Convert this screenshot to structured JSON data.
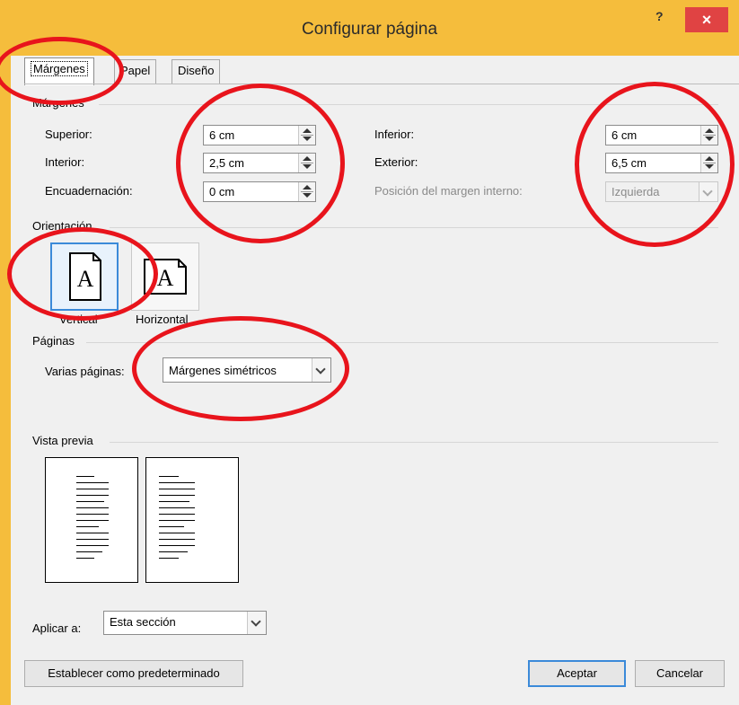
{
  "window": {
    "title": "Configurar página",
    "help": "?",
    "close": "×"
  },
  "tabs": [
    {
      "label": "Márgenes",
      "active": true
    },
    {
      "label": "Papel",
      "active": false
    },
    {
      "label": "Diseño",
      "active": false
    }
  ],
  "margins": {
    "section_label": "Márgenes",
    "superior": {
      "label": "Superior:",
      "value": "6 cm"
    },
    "interior": {
      "label": "Interior:",
      "value": "2,5 cm"
    },
    "encuadernacion": {
      "label": "Encuadernación:",
      "value": "0 cm"
    },
    "inferior": {
      "label": "Inferior:",
      "value": "6 cm"
    },
    "exterior": {
      "label": "Exterior:",
      "value": "6,5 cm"
    },
    "gutter_position": {
      "label": "Posición del margen interno:",
      "value": "Izquierda",
      "enabled": false
    }
  },
  "orientation": {
    "section_label": "Orientación",
    "vertical": {
      "label": "Vertical",
      "selected": true
    },
    "horizontal": {
      "label": "Horizontal",
      "selected": false
    },
    "glyph": "A"
  },
  "pages": {
    "section_label": "Páginas",
    "multiple_label": "Varias páginas:",
    "multiple_value": "Márgenes simétricos"
  },
  "preview": {
    "section_label": "Vista previa"
  },
  "apply": {
    "label": "Aplicar a:",
    "value": "Esta sección"
  },
  "buttons": {
    "default": "Establecer como predeterminado",
    "ok": "Aceptar",
    "cancel": "Cancelar"
  },
  "colors": {
    "title_bar": "#f5bd3c",
    "close_button": "#e04343",
    "annotation_circles": "#e8141c",
    "selection": "#3b8ad9"
  }
}
